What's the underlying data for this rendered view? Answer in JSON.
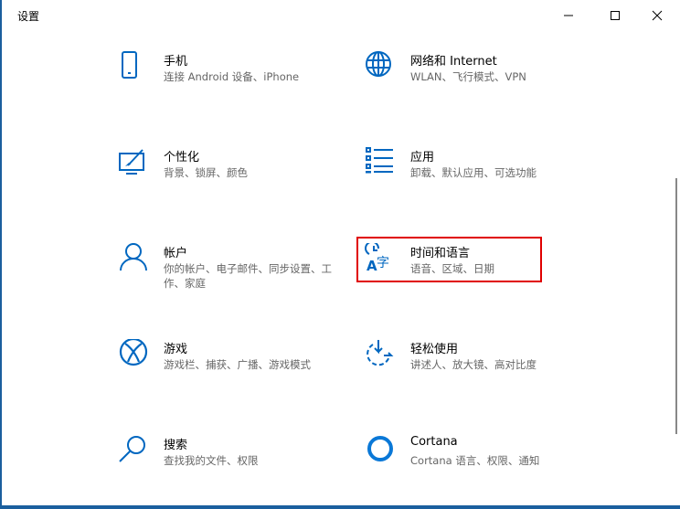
{
  "window": {
    "title": "设置"
  },
  "controls": {
    "minimize": "minimize",
    "maximize": "maximize",
    "close": "close"
  },
  "accent": "#0067c0",
  "items": [
    {
      "title": "手机",
      "subtitle": "连接 Android 设备、iPhone",
      "icon": "phone-icon"
    },
    {
      "title": "网络和 Internet",
      "subtitle": "WLAN、飞行模式、VPN",
      "icon": "globe-icon"
    },
    {
      "title": "个性化",
      "subtitle": "背景、锁屏、颜色",
      "icon": "personalization-icon"
    },
    {
      "title": "应用",
      "subtitle": "卸载、默认应用、可选功能",
      "icon": "apps-list-icon"
    },
    {
      "title": "帐户",
      "subtitle": "你的帐户、电子邮件、同步设置、工作、家庭",
      "icon": "person-icon"
    },
    {
      "title": "时间和语言",
      "subtitle": "语音、区域、日期",
      "icon": "time-language-icon"
    },
    {
      "title": "游戏",
      "subtitle": "游戏栏、捕获、广播、游戏模式",
      "icon": "xbox-icon"
    },
    {
      "title": "轻松使用",
      "subtitle": "讲述人、放大镜、高对比度",
      "icon": "ease-of-access-icon"
    },
    {
      "title": "搜索",
      "subtitle": "查找我的文件、权限",
      "icon": "search-icon"
    },
    {
      "title": "Cortana",
      "subtitle": "Cortana 语言、权限、通知",
      "icon": "cortana-icon"
    }
  ]
}
